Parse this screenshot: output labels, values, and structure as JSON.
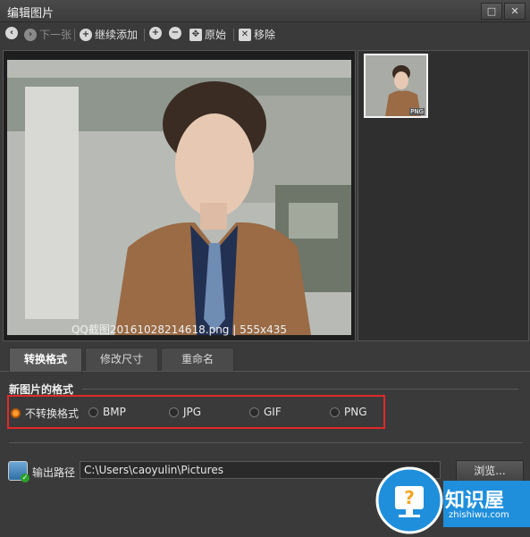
{
  "window": {
    "title": "编辑图片",
    "restore_glyph": "□",
    "close_glyph": "✕"
  },
  "toolbar": {
    "prev_icon": "arrow-left-icon",
    "next_label": "下一张",
    "add_label": "继续添加",
    "zoom_in_icon": "zoom-in-icon",
    "zoom_out_icon": "zoom-out-icon",
    "original_label": "原始",
    "remove_label": "移除"
  },
  "preview": {
    "caption": "QQ截图20161028214618.png | 555x435"
  },
  "thumbnail": {
    "tag": "PNG"
  },
  "tabs": [
    {
      "label": "转换格式"
    },
    {
      "label": "修改尺寸"
    },
    {
      "label": "重命名"
    }
  ],
  "format": {
    "section_title": "新图片的格式",
    "options": [
      {
        "label": "不转换格式",
        "selected": true
      },
      {
        "label": "BMP",
        "selected": false
      },
      {
        "label": "JPG",
        "selected": false
      },
      {
        "label": "GIF",
        "selected": false
      },
      {
        "label": "PNG",
        "selected": false
      }
    ]
  },
  "output": {
    "label": "输出路径",
    "path": "C:\\Users\\caoyulin\\Pictures",
    "browse_label": "浏览..."
  },
  "watermark": {
    "brand": "知识屋",
    "url": "zhishiwu.com"
  },
  "colors": {
    "highlight": "#e0282a",
    "accent": "#1f8fdc"
  }
}
